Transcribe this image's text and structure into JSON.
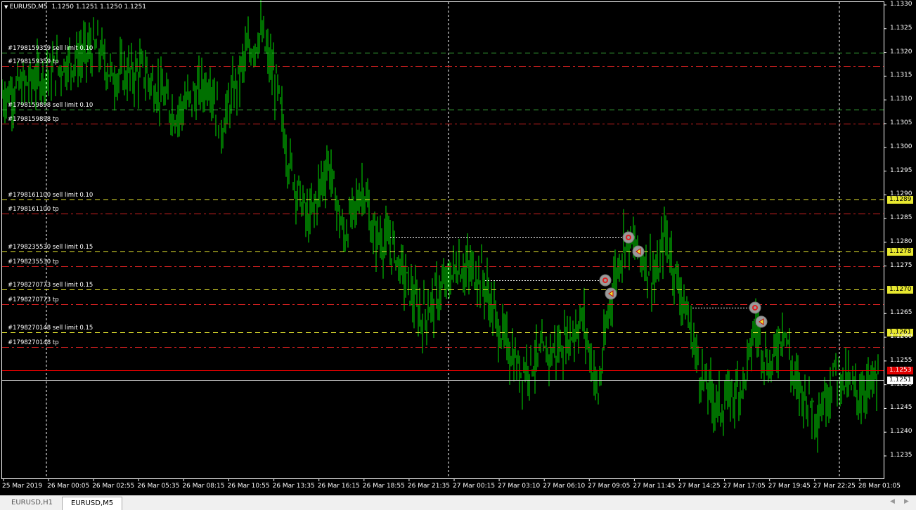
{
  "header": {
    "symbol": "EURUSD,M5",
    "ohlc": "1.1250 1.1251 1.1250 1.1251",
    "menu_icon": "triangle-down-icon"
  },
  "price_axis": [
    "1.1330",
    "1.1325",
    "1.1320",
    "1.1315",
    "1.1310",
    "1.1305",
    "1.1300",
    "1.1295",
    "1.1290",
    "1.1285",
    "1.1280",
    "1.1275",
    "1.1265",
    "1.1260",
    "1.1255",
    "1.1250",
    "1.1245",
    "1.1240",
    "1.1235"
  ],
  "time_axis": [
    "25 Mar 2019",
    "26 Mar 00:05",
    "26 Mar 02:55",
    "26 Mar 05:35",
    "26 Mar 08:15",
    "26 Mar 10:55",
    "26 Mar 13:35",
    "26 Mar 16:15",
    "26 Mar 18:55",
    "26 Mar 21:35",
    "27 Mar 00:15",
    "27 Mar 03:10",
    "27 Mar 06:10",
    "27 Mar 09:05",
    "27 Mar 11:45",
    "27 Mar 14:25",
    "27 Mar 17:05",
    "27 Mar 19:45",
    "27 Mar 22:25",
    "28 Mar 01:05"
  ],
  "orders": [
    {
      "label": "#1798159359 sell limit 0.10",
      "price": 1.132,
      "type": "limit",
      "color": "#3cb43c"
    },
    {
      "label": "#1798159359 tp",
      "price": 1.13171,
      "type": "tp",
      "color": "#d02020"
    },
    {
      "label": "#1798159898 sell limit 0.10",
      "price": 1.1308,
      "type": "limit",
      "color": "#3cb43c"
    },
    {
      "label": "#1798159898 tp",
      "price": 1.1305,
      "type": "tp",
      "color": "#d02020"
    },
    {
      "label": "#1798161100 sell limit 0.10",
      "price": 1.1289,
      "type": "limit",
      "color": "#e8e830",
      "tag": "1.1289"
    },
    {
      "label": "#1798161100 tp",
      "price": 1.1286,
      "type": "tp",
      "color": "#d02020"
    },
    {
      "label": "#1798235530 sell limit 0.15",
      "price": 1.1278,
      "type": "limit",
      "color": "#e8e830",
      "tag": "1.1278"
    },
    {
      "label": "#1798235530 tp",
      "price": 1.1275,
      "type": "tp",
      "color": "#d02020"
    },
    {
      "label": "#1798270773 sell limit 0.15",
      "price": 1.127,
      "type": "limit",
      "color": "#e8e830",
      "tag": "1.1270"
    },
    {
      "label": "#1798270773 tp",
      "price": 1.1267,
      "type": "tp",
      "color": "#d02020"
    },
    {
      "label": "#1798270148 sell limit 0.15",
      "price": 1.1261,
      "type": "limit",
      "color": "#e8e830",
      "tag": "1.1261"
    },
    {
      "label": "#1798270148 tp",
      "price": 1.1258,
      "type": "tp",
      "color": "#d02020"
    }
  ],
  "ask": {
    "price": 1.1253,
    "tag": "1.1253",
    "color": "#e00000"
  },
  "bid": {
    "price": 1.1251,
    "tag": "1.1251",
    "color": "#c0c0c0"
  },
  "chart_data": {
    "type": "bar",
    "symbol": "EURUSD",
    "timeframe": "M5",
    "ylim": [
      1.123,
      1.1332
    ],
    "keypoints": [
      [
        1,
        1.1311
      ],
      [
        28,
        1.1315
      ],
      [
        68,
        1.1321
      ],
      [
        78,
        1.1315
      ],
      [
        101,
        1.1316
      ],
      [
        123,
        1.1307
      ],
      [
        148,
        1.1314
      ],
      [
        156,
        1.1304
      ],
      [
        173,
        1.1319
      ],
      [
        184,
        1.1324
      ],
      [
        196,
        1.1312
      ],
      [
        203,
        1.1298
      ],
      [
        218,
        1.1284
      ],
      [
        232,
        1.1297
      ],
      [
        243,
        1.1281
      ],
      [
        257,
        1.1292
      ],
      [
        263,
        1.1282
      ],
      [
        278,
        1.1279
      ],
      [
        298,
        1.1264
      ],
      [
        318,
        1.1272
      ],
      [
        323,
        1.1275
      ],
      [
        341,
        1.1273
      ],
      [
        353,
        1.1262
      ],
      [
        368,
        1.1253
      ],
      [
        378,
        1.1255
      ],
      [
        398,
        1.1258
      ],
      [
        413,
        1.1264
      ],
      [
        424,
        1.1248
      ],
      [
        433,
        1.1269
      ],
      [
        443,
        1.1281
      ],
      [
        453,
        1.1278
      ],
      [
        466,
        1.1272
      ],
      [
        471,
        1.1282
      ],
      [
        486,
        1.1266
      ],
      [
        498,
        1.1251
      ],
      [
        511,
        1.1245
      ],
      [
        528,
        1.1251
      ],
      [
        536,
        1.1263
      ],
      [
        546,
        1.1253
      ],
      [
        556,
        1.1263
      ],
      [
        563,
        1.1251
      ],
      [
        581,
        1.1244
      ],
      [
        593,
        1.1253
      ],
      [
        608,
        1.1248
      ],
      [
        623,
        1.1251
      ]
    ],
    "bar_color": "#00e000"
  },
  "tabs": [
    {
      "label": "EURUSD,H1",
      "active": false
    },
    {
      "label": "EURUSD,M5",
      "active": true
    }
  ]
}
